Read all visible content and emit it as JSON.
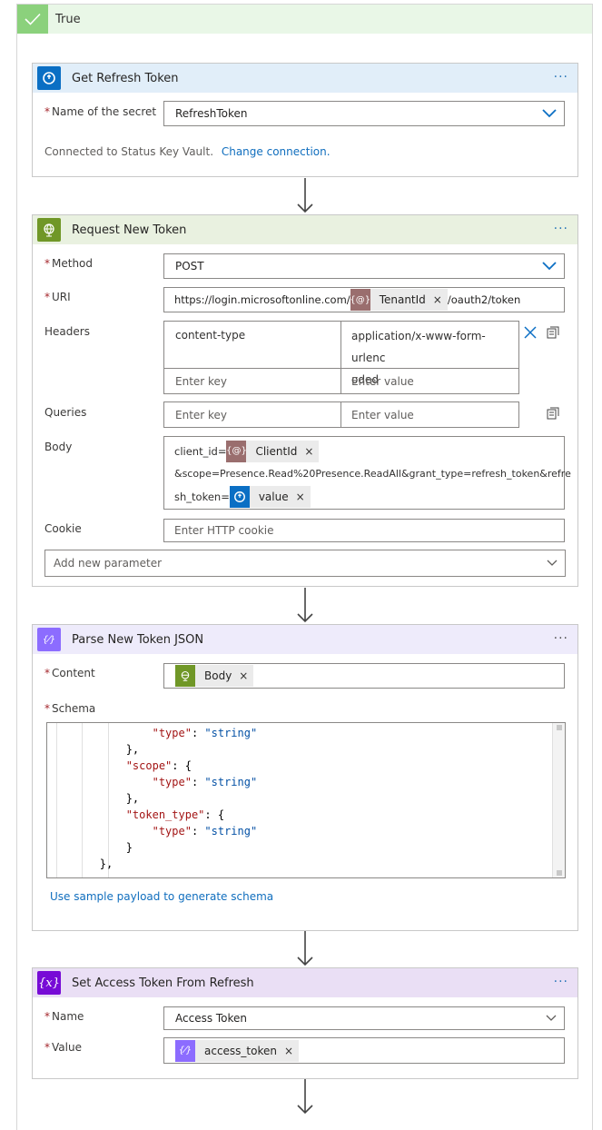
{
  "condition": {
    "label": "True"
  },
  "get_refresh_token": {
    "title": "Get Refresh Token",
    "secret_label": "Name of the secret",
    "secret_value": "RefreshToken",
    "connection_text": "Connected to Status Key Vault.",
    "change_connection": "Change connection.",
    "more": "···"
  },
  "request_new_token": {
    "title": "Request New Token",
    "more": "···",
    "method_label": "Method",
    "method_value": "POST",
    "uri_label": "URI",
    "uri_prefix": "https://login.microsoftonline.com/",
    "uri_token": "TenantId",
    "uri_suffix": "/oauth2/token",
    "headers_label": "Headers",
    "header_key": "content-type",
    "header_value_1": "application/x-www-form-urlenc",
    "header_value_2": "oded",
    "enter_key": "Enter key",
    "enter_value": "Enter value",
    "queries_label": "Queries",
    "body_label": "Body",
    "body_prefix": "client_id=",
    "body_token_1": "ClientId",
    "body_line2": "&scope=Presence.Read%20Presence.ReadAll&grant_type=refresh_token&refre",
    "body_line3_prefix": "sh_token=",
    "body_token_2": "value",
    "cookie_label": "Cookie",
    "cookie_placeholder": "Enter HTTP cookie",
    "add_param": "Add new parameter"
  },
  "parse_json": {
    "title": "Parse New Token JSON",
    "more": "···",
    "content_label": "Content",
    "content_token": "Body",
    "schema_label": "Schema",
    "schema_lines": [
      {
        "indent": "        ",
        "key": "\"type\"",
        "sep": ": ",
        "val": "\"string\""
      },
      {
        "indent": "    ",
        "key": "",
        "sep": "},",
        "val": ""
      },
      {
        "indent": "    ",
        "key": "\"scope\"",
        "sep": ": {",
        "val": ""
      },
      {
        "indent": "        ",
        "key": "\"type\"",
        "sep": ": ",
        "val": "\"string\""
      },
      {
        "indent": "    ",
        "key": "",
        "sep": "},",
        "val": ""
      },
      {
        "indent": "    ",
        "key": "\"token_type\"",
        "sep": ": {",
        "val": ""
      },
      {
        "indent": "        ",
        "key": "\"type\"",
        "sep": ": ",
        "val": "\"string\""
      },
      {
        "indent": "    ",
        "key": "",
        "sep": "}",
        "val": ""
      },
      {
        "indent": "",
        "key": "",
        "sep": "},",
        "val": ""
      }
    ],
    "sample_link": "Use sample payload to generate schema"
  },
  "set_variable": {
    "title": "Set Access Token From Refresh",
    "more": "···",
    "name_label": "Name",
    "name_value": "Access Token",
    "value_label": "Value",
    "value_token": "access_token"
  },
  "required_mark": "*",
  "token_close": "×",
  "colors": {
    "keyvault": "#0b6fc4",
    "http": "#709727",
    "parse": "#8c6cff",
    "variable": "#770bd6",
    "var_token": "#9a6e6e"
  }
}
